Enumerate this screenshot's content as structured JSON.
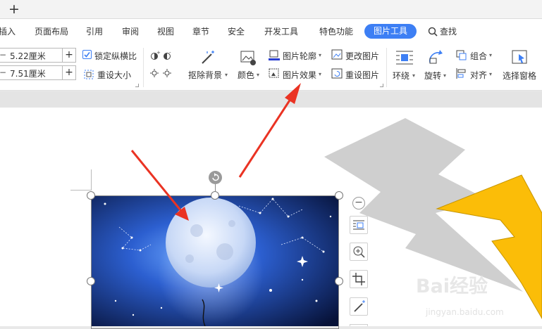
{
  "titlebar": {
    "new_tab_label": "+"
  },
  "tabs": [
    "插入",
    "页面布局",
    "引用",
    "审阅",
    "视图",
    "章节",
    "安全",
    "开发工具",
    "特色功能",
    "图片工具"
  ],
  "search_label": "查找",
  "ribbon": {
    "height_value": "5.22厘米",
    "width_value": "7.51厘米",
    "lock_ratio": "锁定纵横比",
    "resize": "重设大小",
    "remove_bg": "抠除背景",
    "color": "颜色",
    "outline": "图片轮廓",
    "effect": "图片效果",
    "change_pic": "更改图片",
    "reset_pic": "重设图片",
    "wrap": "环绕",
    "rotate": "旋转",
    "group": "组合",
    "align": "对齐",
    "select_pane": "选择窗格"
  },
  "watermark": {
    "main": "Bai经验",
    "sub": "jingyan.baidu.com"
  },
  "colors": {
    "accent": "#3d7ff4",
    "shape": "#fbbd08",
    "annotation": "#ea3323"
  }
}
